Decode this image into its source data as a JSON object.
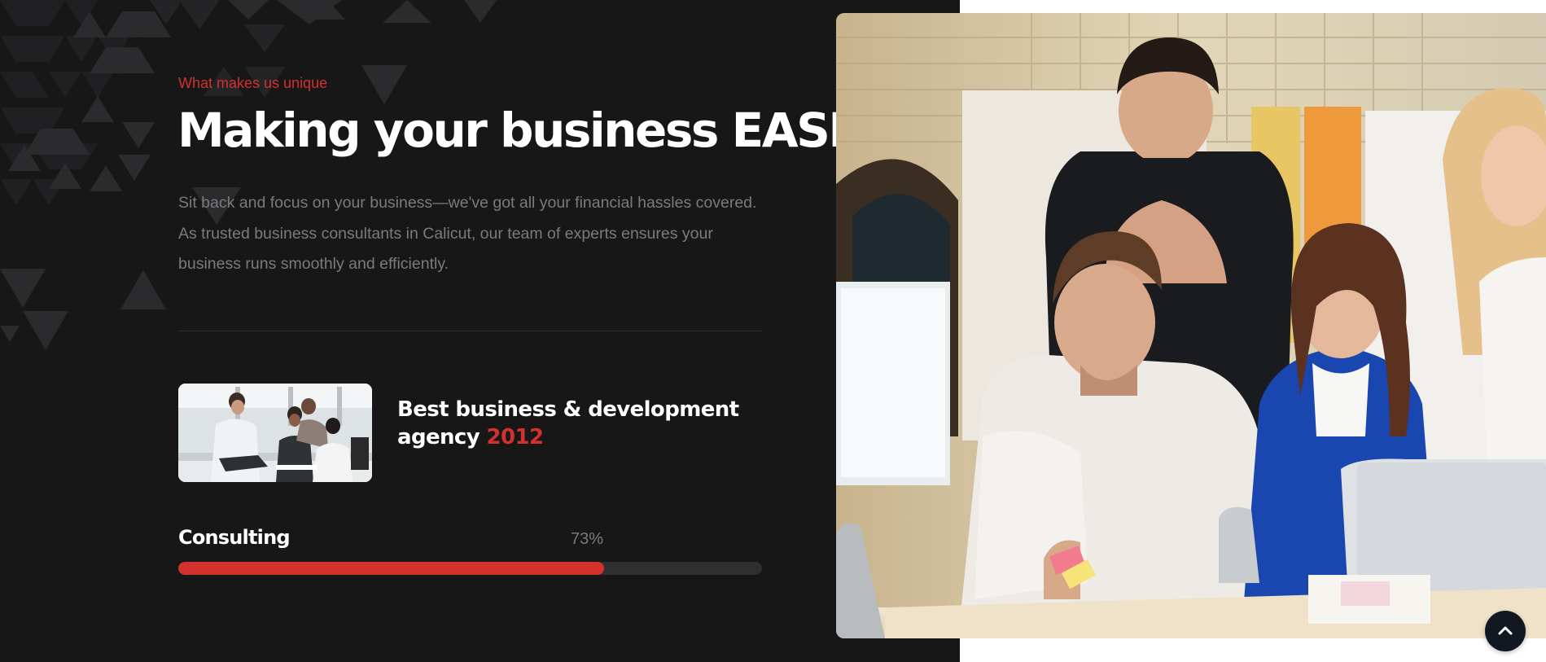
{
  "section": {
    "eyebrow": "What makes us unique",
    "headline": "Making your business EASIER",
    "intro": "Sit back and focus on your business—we've got all your financial hassles covered. As trusted business consultants in Calicut, our team of experts ensures your business runs smoothly and efficiently."
  },
  "feature": {
    "title_prefix": "Best business & development agency",
    "year": "2012",
    "thumbnail_icon": "team-meeting-photo"
  },
  "skill": {
    "label": "Consulting",
    "value_text": "73%",
    "progress": 0.73
  },
  "hero": {
    "image_icon": "office-team-photo"
  },
  "scroll_top": {
    "icon": "chevron-up-icon"
  },
  "colors": {
    "panel_bg": "#171718",
    "accent": "#d2312d",
    "muted_text": "#7b7b7d",
    "track": "#2f2f31",
    "back_to_top_bg": "#121822"
  }
}
